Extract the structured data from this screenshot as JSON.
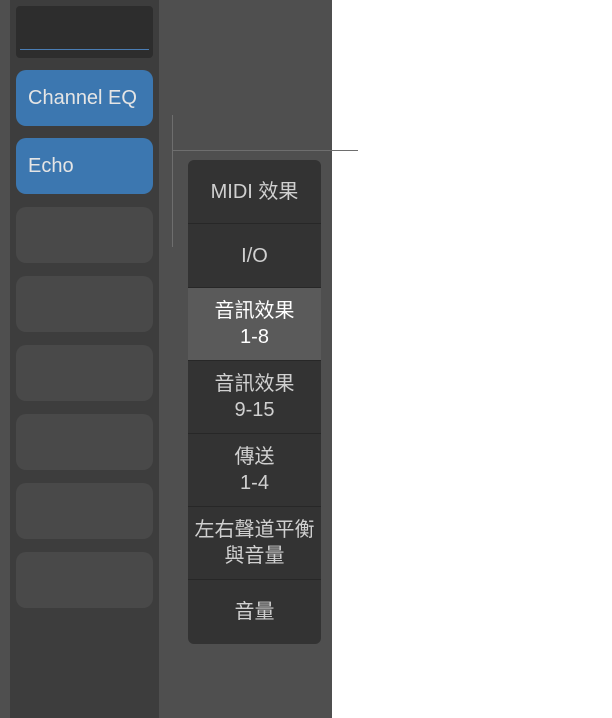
{
  "plugins": {
    "slot1": "Channel EQ",
    "slot2": "Echo"
  },
  "menu": {
    "items": [
      {
        "label": "MIDI 效果",
        "selected": false
      },
      {
        "label": "I/O",
        "selected": false
      },
      {
        "label_line1": "音訊效果",
        "label_line2": "1-8",
        "selected": true
      },
      {
        "label_line1": "音訊效果",
        "label_line2": "9-15",
        "selected": false
      },
      {
        "label_line1": "傳送",
        "label_line2": "1-4",
        "selected": false
      },
      {
        "label_line1": "左右聲道平衡",
        "label_line2": "與音量",
        "selected": false
      },
      {
        "label": "音量",
        "selected": false
      }
    ]
  }
}
